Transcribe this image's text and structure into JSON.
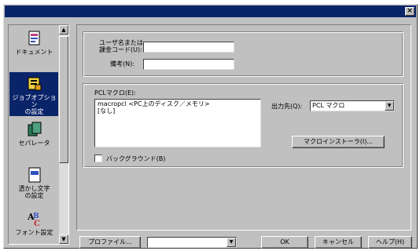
{
  "window": {
    "close_glyph": "×"
  },
  "sidebar": {
    "items": [
      {
        "label": "ドキュメント",
        "icon": "document-icon"
      },
      {
        "label": "ジョブオプション\nの設定",
        "icon": "job-options-icon",
        "selected": true
      },
      {
        "label": "セパレータ",
        "icon": "separator-icon"
      },
      {
        "label": "透かし文字\nの設定",
        "icon": "watermark-icon"
      },
      {
        "label": "フォント設定",
        "icon": "font-settings-icon"
      }
    ]
  },
  "job": {
    "user_name_label": "ユーザ名または\n課金コード(U):",
    "user_name_value": "",
    "remarks_label": "備考(N):",
    "remarks_value": ""
  },
  "pcl_macro": {
    "group_label": "PCLマクロ(E):",
    "list": [
      "macropcl   <PC上のディスク／メモリ>",
      "[なし]"
    ],
    "dest_label": "出力先(Q):",
    "dest_value": "PCL マクロ",
    "installer_button": "マクロインストーラ(I)...",
    "background_label": "バックグラウンド(B)"
  },
  "footer": {
    "profile_button": "プロファイル...",
    "profile_select_value": "",
    "ok_button": "OK",
    "cancel_button": "キャンセル",
    "help_button": "ヘルプ(H)"
  }
}
